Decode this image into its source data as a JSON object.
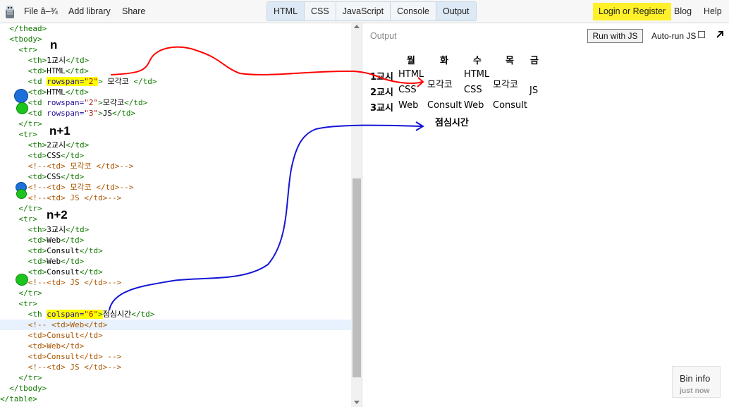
{
  "topbar": {
    "file_label": "File â–¾",
    "add_library_label": "Add library",
    "share_label": "Share",
    "tabs": [
      "HTML",
      "CSS",
      "JavaScript",
      "Console",
      "Output"
    ],
    "login_label": "Login or Register",
    "blog_label": "Blog",
    "help_label": "Help"
  },
  "editor": {
    "lines": [
      {
        "indent": "  ",
        "parts": [
          [
            "tag",
            "</thead>"
          ]
        ]
      },
      {
        "indent": "  ",
        "parts": [
          [
            "tag",
            "<tbody>"
          ]
        ]
      },
      {
        "indent": "    ",
        "parts": [
          [
            "tag",
            "<tr>"
          ]
        ]
      },
      {
        "indent": "      ",
        "parts": [
          [
            "tag",
            "<th>"
          ],
          [
            "txt",
            "1교시"
          ],
          [
            "tag",
            "</td>"
          ]
        ]
      },
      {
        "indent": "      ",
        "parts": [
          [
            "tag",
            "<td>"
          ],
          [
            "txt",
            "HTML"
          ],
          [
            "tag",
            "</td>"
          ]
        ]
      },
      {
        "indent": "      ",
        "parts": [
          [
            "tag",
            "<td "
          ],
          [
            "hattr",
            "rowspan="
          ],
          [
            "hstr",
            "\"2\""
          ],
          [
            "tag",
            ">"
          ],
          [
            "txt",
            " 모각코 "
          ],
          [
            "tag",
            "</td>"
          ]
        ]
      },
      {
        "indent": "      ",
        "parts": [
          [
            "tag",
            "<td>"
          ],
          [
            "txt",
            "HTML"
          ],
          [
            "tag",
            "</td>"
          ]
        ]
      },
      {
        "indent": "      ",
        "parts": [
          [
            "tag",
            "<td "
          ],
          [
            "attr",
            "rowspan="
          ],
          [
            "str",
            "\"2\""
          ],
          [
            "tag",
            ">"
          ],
          [
            "txt",
            "모각코"
          ],
          [
            "tag",
            "</td>"
          ]
        ]
      },
      {
        "indent": "      ",
        "parts": [
          [
            "tag",
            "<td "
          ],
          [
            "attr",
            "rowspan="
          ],
          [
            "str",
            "\"3\""
          ],
          [
            "tag",
            ">"
          ],
          [
            "txt",
            "JS"
          ],
          [
            "tag",
            "</td>"
          ]
        ]
      },
      {
        "indent": "    ",
        "parts": [
          [
            "tag",
            "</tr>"
          ]
        ]
      },
      {
        "indent": "    ",
        "parts": [
          [
            "tag",
            "<tr>"
          ]
        ]
      },
      {
        "indent": "      ",
        "parts": [
          [
            "tag",
            "<th>"
          ],
          [
            "txt",
            "2교시"
          ],
          [
            "tag",
            "</td>"
          ]
        ]
      },
      {
        "indent": "      ",
        "parts": [
          [
            "tag",
            "<td>"
          ],
          [
            "txt",
            "CSS"
          ],
          [
            "tag",
            "</td>"
          ]
        ]
      },
      {
        "indent": "      ",
        "parts": [
          [
            "cmt",
            "<!--<td> 모각코 </td>-->"
          ]
        ]
      },
      {
        "indent": "      ",
        "parts": [
          [
            "tag",
            "<td>"
          ],
          [
            "txt",
            "CSS"
          ],
          [
            "tag",
            "</td>"
          ]
        ]
      },
      {
        "indent": "      ",
        "parts": [
          [
            "cmt",
            "<!--<td> 모각코 </td>-->"
          ]
        ]
      },
      {
        "indent": "      ",
        "parts": [
          [
            "cmt",
            "<!--<td> JS </td>-->"
          ]
        ]
      },
      {
        "indent": "    ",
        "parts": [
          [
            "tag",
            "</tr>"
          ]
        ]
      },
      {
        "indent": "    ",
        "parts": [
          [
            "tag",
            "<tr>"
          ]
        ]
      },
      {
        "indent": "      ",
        "parts": [
          [
            "tag",
            "<th>"
          ],
          [
            "txt",
            "3교시"
          ],
          [
            "tag",
            "</td>"
          ]
        ]
      },
      {
        "indent": "      ",
        "parts": [
          [
            "tag",
            "<td>"
          ],
          [
            "txt",
            "Web"
          ],
          [
            "tag",
            "</td>"
          ]
        ]
      },
      {
        "indent": "      ",
        "parts": [
          [
            "tag",
            "<td>"
          ],
          [
            "txt",
            "Consult"
          ],
          [
            "tag",
            "</td>"
          ]
        ]
      },
      {
        "indent": "      ",
        "parts": [
          [
            "tag",
            "<td>"
          ],
          [
            "txt",
            "Web"
          ],
          [
            "tag",
            "</td>"
          ]
        ]
      },
      {
        "indent": "      ",
        "parts": [
          [
            "tag",
            "<td>"
          ],
          [
            "txt",
            "Consult"
          ],
          [
            "tag",
            "</td>"
          ]
        ]
      },
      {
        "indent": "      ",
        "parts": [
          [
            "cmt",
            "<!--<td> JS </td>-->"
          ]
        ]
      },
      {
        "indent": "    ",
        "parts": [
          [
            "tag",
            "</tr>"
          ]
        ]
      },
      {
        "indent": "    ",
        "parts": [
          [
            "tag",
            "<tr>"
          ]
        ]
      },
      {
        "indent": "      ",
        "parts": [
          [
            "tag",
            "<th "
          ],
          [
            "hattr",
            "colspan="
          ],
          [
            "hstr",
            "\"6\""
          ],
          [
            "htag",
            ">"
          ],
          [
            "txt",
            "점심시간"
          ],
          [
            "tag",
            "</td>"
          ]
        ]
      },
      {
        "indent": "      ",
        "parts": [
          [
            "cmt",
            "<!-- <td>Web</td>"
          ]
        ]
      },
      {
        "indent": "      ",
        "parts": [
          [
            "cmt",
            "<td>Consult</td>"
          ]
        ]
      },
      {
        "indent": "      ",
        "parts": [
          [
            "cmt",
            "<td>Web</td>"
          ]
        ]
      },
      {
        "indent": "      ",
        "parts": [
          [
            "cmt",
            "<td>Consult</td> -->"
          ]
        ]
      },
      {
        "indent": "      ",
        "parts": [
          [
            "cmt",
            "<!--<td> JS </td>-->"
          ]
        ]
      },
      {
        "indent": "    ",
        "parts": [
          [
            "tag",
            "</tr>"
          ]
        ]
      },
      {
        "indent": "  ",
        "parts": [
          [
            "tag",
            "</tbody>"
          ]
        ]
      },
      {
        "indent": "",
        "parts": [
          [
            "tag",
            "</table>"
          ]
        ]
      }
    ],
    "annotations": {
      "n": "n",
      "n1": "n+1",
      "n2": "n+2"
    }
  },
  "output": {
    "label": "Output",
    "run_label": "Run with JS",
    "autorun_label": "Auto-run JS",
    "days": [
      "월",
      "화",
      "수",
      "목",
      "금"
    ],
    "rows": {
      "p1": "1교시",
      "p2": "2교시",
      "p3": "3교시",
      "r1_html": "HTML",
      "r1_mogak": "모각코",
      "r1_html2": "HTML",
      "r1_mogak2": "모각코",
      "js": "JS",
      "r2_css": "CSS",
      "r2_css2": "CSS",
      "r3_web": "Web",
      "r3_consult": "Consult",
      "r3_web2": "Web",
      "r3_consult2": "Consult",
      "lunch": "점심시간"
    }
  },
  "bininfo": {
    "title": "Bin info",
    "subtitle": "just now"
  },
  "colors": {
    "highlight": "#ffff00",
    "login_bg": "#fff02a",
    "red_arrow": "#ff0000",
    "blue_arrow": "#1515d6",
    "dot_blue": "#1e6fd9",
    "dot_green": "#1ec41e"
  }
}
